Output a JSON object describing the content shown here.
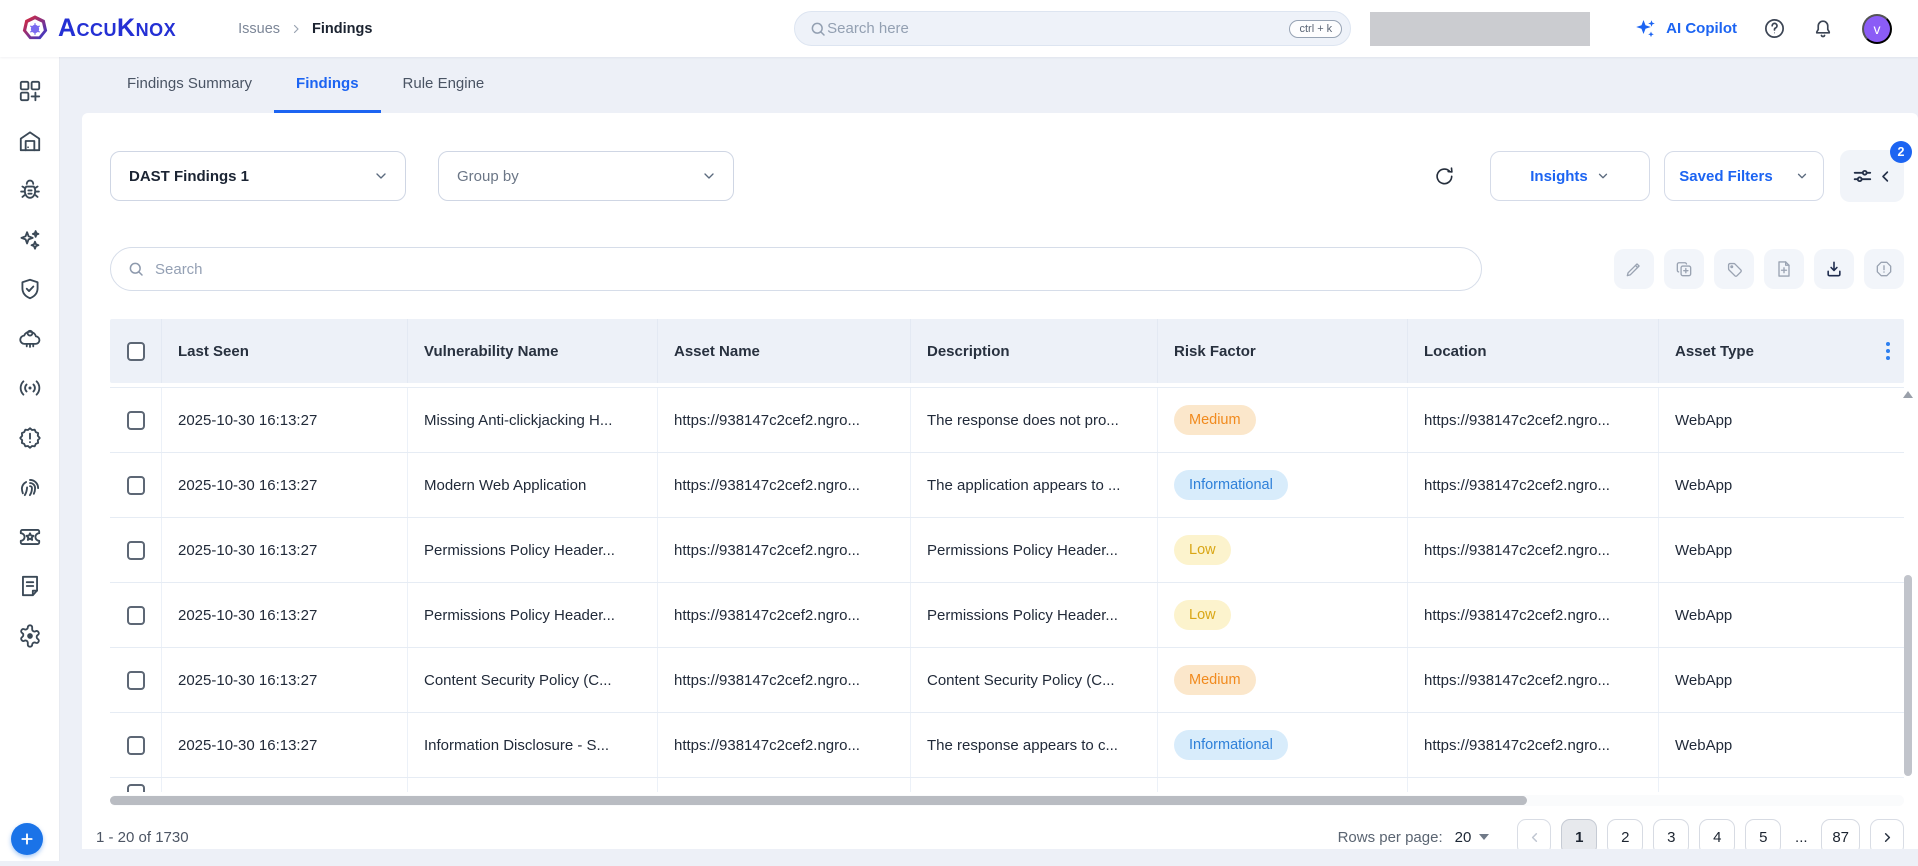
{
  "header": {
    "logo_text": "AccuKnox",
    "breadcrumb": {
      "parent": "Issues",
      "current": "Findings"
    },
    "search": {
      "placeholder": "Search here",
      "shortcut": "ctrl + k"
    },
    "ai_copilot_label": "AI Copilot",
    "avatar_initial": "v"
  },
  "sidebar": {
    "items": [
      "dashboard",
      "inventory",
      "issues",
      "ai-assist",
      "compliance",
      "runtime-security",
      "network",
      "alerts",
      "identity",
      "tickets",
      "reports",
      "settings"
    ],
    "fab": "create"
  },
  "tabs": [
    {
      "label": "Findings Summary",
      "active": false
    },
    {
      "label": "Findings",
      "active": true
    },
    {
      "label": "Rule Engine",
      "active": false
    }
  ],
  "filters": {
    "finding_type_value": "DAST Findings 1",
    "group_by_placeholder": "Group by",
    "insights_label": "Insights",
    "saved_filters_label": "Saved Filters",
    "filter_badge_count": "2"
  },
  "toolbar": {
    "search_placeholder": "Search",
    "actions": [
      "edit",
      "duplicate",
      "tag",
      "create-ticket",
      "download",
      "report-issue"
    ]
  },
  "table": {
    "columns": [
      "Last Seen",
      "Vulnerability Name",
      "Asset Name",
      "Description",
      "Risk Factor",
      "Location",
      "Asset Type"
    ],
    "rows": [
      {
        "last_seen": "2025-10-30 16:13:27",
        "vulnerability": "Missing Anti-clickjacking H...",
        "asset": "https://938147c2cef2.ngro...",
        "description": "The response does not pro...",
        "risk": "Medium",
        "location": "https://938147c2cef2.ngro...",
        "asset_type": "WebApp"
      },
      {
        "last_seen": "2025-10-30 16:13:27",
        "vulnerability": "Modern Web Application",
        "asset": "https://938147c2cef2.ngro...",
        "description": "The application appears to ...",
        "risk": "Informational",
        "location": "https://938147c2cef2.ngro...",
        "asset_type": "WebApp"
      },
      {
        "last_seen": "2025-10-30 16:13:27",
        "vulnerability": "Permissions Policy Header...",
        "asset": "https://938147c2cef2.ngro...",
        "description": "Permissions Policy Header...",
        "risk": "Low",
        "location": "https://938147c2cef2.ngro...",
        "asset_type": "WebApp"
      },
      {
        "last_seen": "2025-10-30 16:13:27",
        "vulnerability": "Permissions Policy Header...",
        "asset": "https://938147c2cef2.ngro...",
        "description": "Permissions Policy Header...",
        "risk": "Low",
        "location": "https://938147c2cef2.ngro...",
        "asset_type": "WebApp"
      },
      {
        "last_seen": "2025-10-30 16:13:27",
        "vulnerability": "Content Security Policy (C...",
        "asset": "https://938147c2cef2.ngro...",
        "description": "Content Security Policy (C...",
        "risk": "Medium",
        "location": "https://938147c2cef2.ngro...",
        "asset_type": "WebApp"
      },
      {
        "last_seen": "2025-10-30 16:13:27",
        "vulnerability": "Information Disclosure - S...",
        "asset": "https://938147c2cef2.ngro...",
        "description": "The response appears to c...",
        "risk": "Informational",
        "location": "https://938147c2cef2.ngro...",
        "asset_type": "WebApp"
      }
    ]
  },
  "footer": {
    "range_label": "1 - 20 of 1730",
    "rows_per_page_label": "Rows per page:",
    "rows_per_page_value": "20",
    "pages": [
      {
        "label": "1",
        "active": true
      },
      {
        "label": "2"
      },
      {
        "label": "3"
      },
      {
        "label": "4"
      },
      {
        "label": "5"
      },
      {
        "label": "...",
        "ellipsis": true
      },
      {
        "label": "87"
      }
    ]
  },
  "colors": {
    "accent_blue": "#1c64f2",
    "logo_blue": "#2430d4",
    "avatar_purple": "#8b5cf6",
    "severity": {
      "medium": {
        "bg": "#fbe7cb",
        "text": "#f18a1d"
      },
      "low": {
        "bg": "#fcf3cd",
        "text": "#d9a615"
      },
      "informational": {
        "bg": "#d8ecfb",
        "text": "#2e80d9"
      }
    }
  }
}
